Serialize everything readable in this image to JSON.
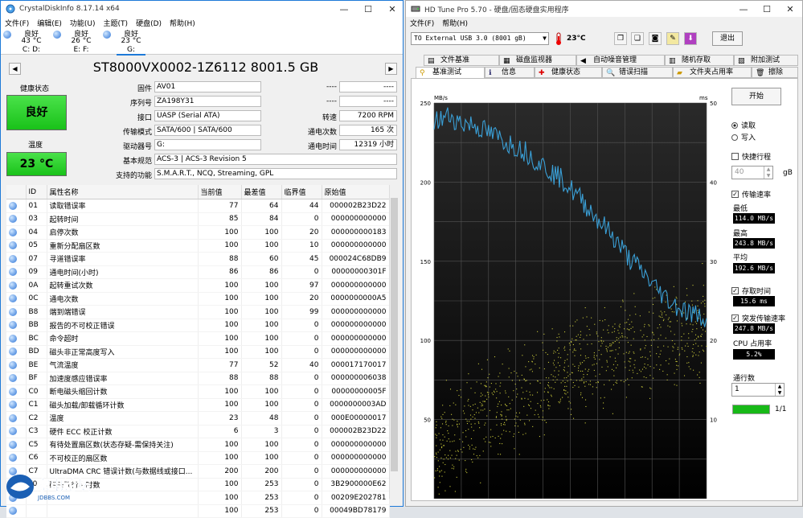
{
  "cdi": {
    "title": "CrystalDiskInfo 8.17.14 x64",
    "menu": [
      "文件(F)",
      "编辑(E)",
      "功能(U)",
      "主题(T)",
      "硬盘(D)",
      "帮助(H)"
    ],
    "drives": [
      {
        "status": "良好",
        "temp": "43 °C",
        "letter": "C: D:"
      },
      {
        "status": "良好",
        "temp": "26 °C",
        "letter": "E: F:"
      },
      {
        "status": "良好",
        "temp": "23 °C",
        "letter": "G:"
      }
    ],
    "disk_title": "ST8000VX0002-1Z6112 8001.5 GB",
    "health_label": "健康状态",
    "health_value": "良好",
    "temp_label": "温度",
    "temp_value": "23 °C",
    "labels": {
      "firmware": "固件",
      "serial": "序列号",
      "interface": "接口",
      "transfer": "传输模式",
      "drive_letter": "驱动器号",
      "standard": "基本规范",
      "features": "支持的功能",
      "rpm": "转速",
      "power_count": "通电次数",
      "power_hours": "通电时间"
    },
    "values": {
      "firmware": "AV01",
      "serial": "ZA198Y31",
      "interface": "UASP (Serial ATA)",
      "transfer": "SATA/600 | SATA/600",
      "drive_letter": "G:",
      "standard": "ACS-3 | ACS-3 Revision 5",
      "features": "S.M.A.R.T., NCQ, Streaming, GPL",
      "rpm": "7200 RPM",
      "power_count": "165 次",
      "power_hours": "12319 小时",
      "blank1a": "----",
      "blank1b": "----",
      "blank2a": "----",
      "blank2b": "----"
    },
    "table_headers": [
      "ID",
      "属性名称",
      "当前值",
      "最差值",
      "临界值",
      "原始值"
    ],
    "rows": [
      [
        "01",
        "读取错误率",
        "77",
        "64",
        "44",
        "000002B23D22"
      ],
      [
        "03",
        "起转时间",
        "85",
        "84",
        "0",
        "000000000000"
      ],
      [
        "04",
        "启停次数",
        "100",
        "100",
        "20",
        "000000000183"
      ],
      [
        "05",
        "重新分配扇区数",
        "100",
        "100",
        "10",
        "000000000000"
      ],
      [
        "07",
        "寻道错误率",
        "88",
        "60",
        "45",
        "000024C68DB9"
      ],
      [
        "09",
        "通电时间(小时)",
        "86",
        "86",
        "0",
        "00000000301F"
      ],
      [
        "0A",
        "起转重试次数",
        "100",
        "100",
        "97",
        "000000000000"
      ],
      [
        "0C",
        "通电次数",
        "100",
        "100",
        "20",
        "0000000000A5"
      ],
      [
        "B8",
        "端到端错误",
        "100",
        "100",
        "99",
        "000000000000"
      ],
      [
        "BB",
        "报告的不可校正错误",
        "100",
        "100",
        "0",
        "000000000000"
      ],
      [
        "BC",
        "命令超时",
        "100",
        "100",
        "0",
        "000000000000"
      ],
      [
        "BD",
        "磁头非正常高度写入",
        "100",
        "100",
        "0",
        "000000000000"
      ],
      [
        "BE",
        "气流温度",
        "77",
        "52",
        "40",
        "000017170017"
      ],
      [
        "BF",
        "加速度感应错误率",
        "88",
        "88",
        "0",
        "000000006038"
      ],
      [
        "C0",
        "断电磁头缩回计数",
        "100",
        "100",
        "0",
        "00000000005F"
      ],
      [
        "C1",
        "磁头加载/卸载循环计数",
        "100",
        "100",
        "0",
        "0000000003AD"
      ],
      [
        "C2",
        "温度",
        "23",
        "48",
        "0",
        "000E00000017"
      ],
      [
        "C3",
        "硬件 ECC 校正计数",
        "6",
        "3",
        "0",
        "000002B23D22"
      ],
      [
        "C5",
        "有待处置扇区数(状态存疑-需保持关注)",
        "100",
        "100",
        "0",
        "000000000000"
      ],
      [
        "C6",
        "不可校正的扇区数",
        "100",
        "100",
        "0",
        "000000000000"
      ],
      [
        "C7",
        "UltraDMA CRC 错误计数(与数据线或接口...",
        "200",
        "200",
        "0",
        "000000000000"
      ],
      [
        "F0",
        "磁头飞行小时数",
        "100",
        "253",
        "0",
        "3B2900000E62"
      ],
      [
        "",
        "",
        "100",
        "253",
        "0",
        "00209E202781"
      ],
      [
        "",
        "",
        "100",
        "253",
        "0",
        "00049BD78179"
      ]
    ],
    "logo_text": "家电论坛",
    "logo_sub": "JDBBS.COM"
  },
  "hdt": {
    "title": "HD Tune Pro 5.70 - 硬盘/固态硬盘实用程序",
    "menu": [
      "文件(F)",
      "帮助(H)"
    ],
    "drive_select": "TO External USB 3.0 (8001 gB)",
    "temp": "23°C",
    "exit": "退出",
    "tabs_row1": [
      "文件基准",
      "磁盘监视器",
      "自动噪音管理",
      "随机存取",
      "附加测试"
    ],
    "tabs_row2": [
      "基准测试",
      "信息",
      "健康状态",
      "错误扫描",
      "文件夹占用率",
      "擦除"
    ],
    "start": "开始",
    "read": "读取",
    "write": "写入",
    "short_stroke": "快捷行程",
    "short_value": "40",
    "short_unit": "gB",
    "transfer_rate": "传输速率",
    "min_label": "最低",
    "min_value": "114.0 MB/s",
    "max_label": "最高",
    "max_value": "243.8 MB/s",
    "avg_label": "平均",
    "avg_value": "192.6 MB/s",
    "access_label": "存取时间",
    "access_value": "15.6 ms",
    "burst_label": "突发传输速率",
    "burst_value": "247.8 MB/s",
    "cpu_label": "CPU 占用率",
    "cpu_value": "5.2%",
    "passes_label": "通行数",
    "passes_value": "1",
    "progress_text": "1/1",
    "progress": 1.0,
    "colors": {
      "line": "#3a9fd6",
      "scatter": "#c8c83a",
      "bg_top": "#2a2a2a",
      "bg_bottom": "#000000"
    }
  },
  "chart_data": {
    "type": "line",
    "y_left_unit": "MB/s",
    "y_right_unit": "ms",
    "y_left_ticks": [
      "250",
      "200",
      "150",
      "100",
      "50"
    ],
    "y_right_ticks": [
      "50",
      "40",
      "30",
      "20",
      "10"
    ],
    "ylim_left": [
      0,
      250
    ],
    "ylim_right": [
      0,
      50
    ],
    "xlim": [
      0,
      100
    ],
    "grid": true,
    "series": [
      {
        "x": [
          0,
          3,
          6,
          9,
          12,
          15,
          18,
          21,
          24,
          27,
          30,
          33,
          36,
          39,
          42,
          45,
          48,
          51,
          54,
          57,
          60,
          63,
          66,
          69,
          72,
          75,
          78,
          81,
          84,
          87,
          90,
          93,
          96,
          100
        ],
        "values": [
          238,
          240,
          242,
          238,
          237,
          236,
          233,
          230,
          228,
          225,
          223,
          220,
          216,
          212,
          208,
          204,
          200,
          194,
          189,
          183,
          177,
          171,
          165,
          158,
          151,
          146,
          140,
          134,
          129,
          124,
          121,
          118,
          116,
          114
        ]
      }
    ],
    "access_time_ms": {
      "mean": 15.6,
      "trend": [
        [
          0,
          6
        ],
        [
          20,
          11
        ],
        [
          40,
          15
        ],
        [
          60,
          18
        ],
        [
          80,
          20
        ],
        [
          100,
          22
        ]
      ]
    }
  }
}
